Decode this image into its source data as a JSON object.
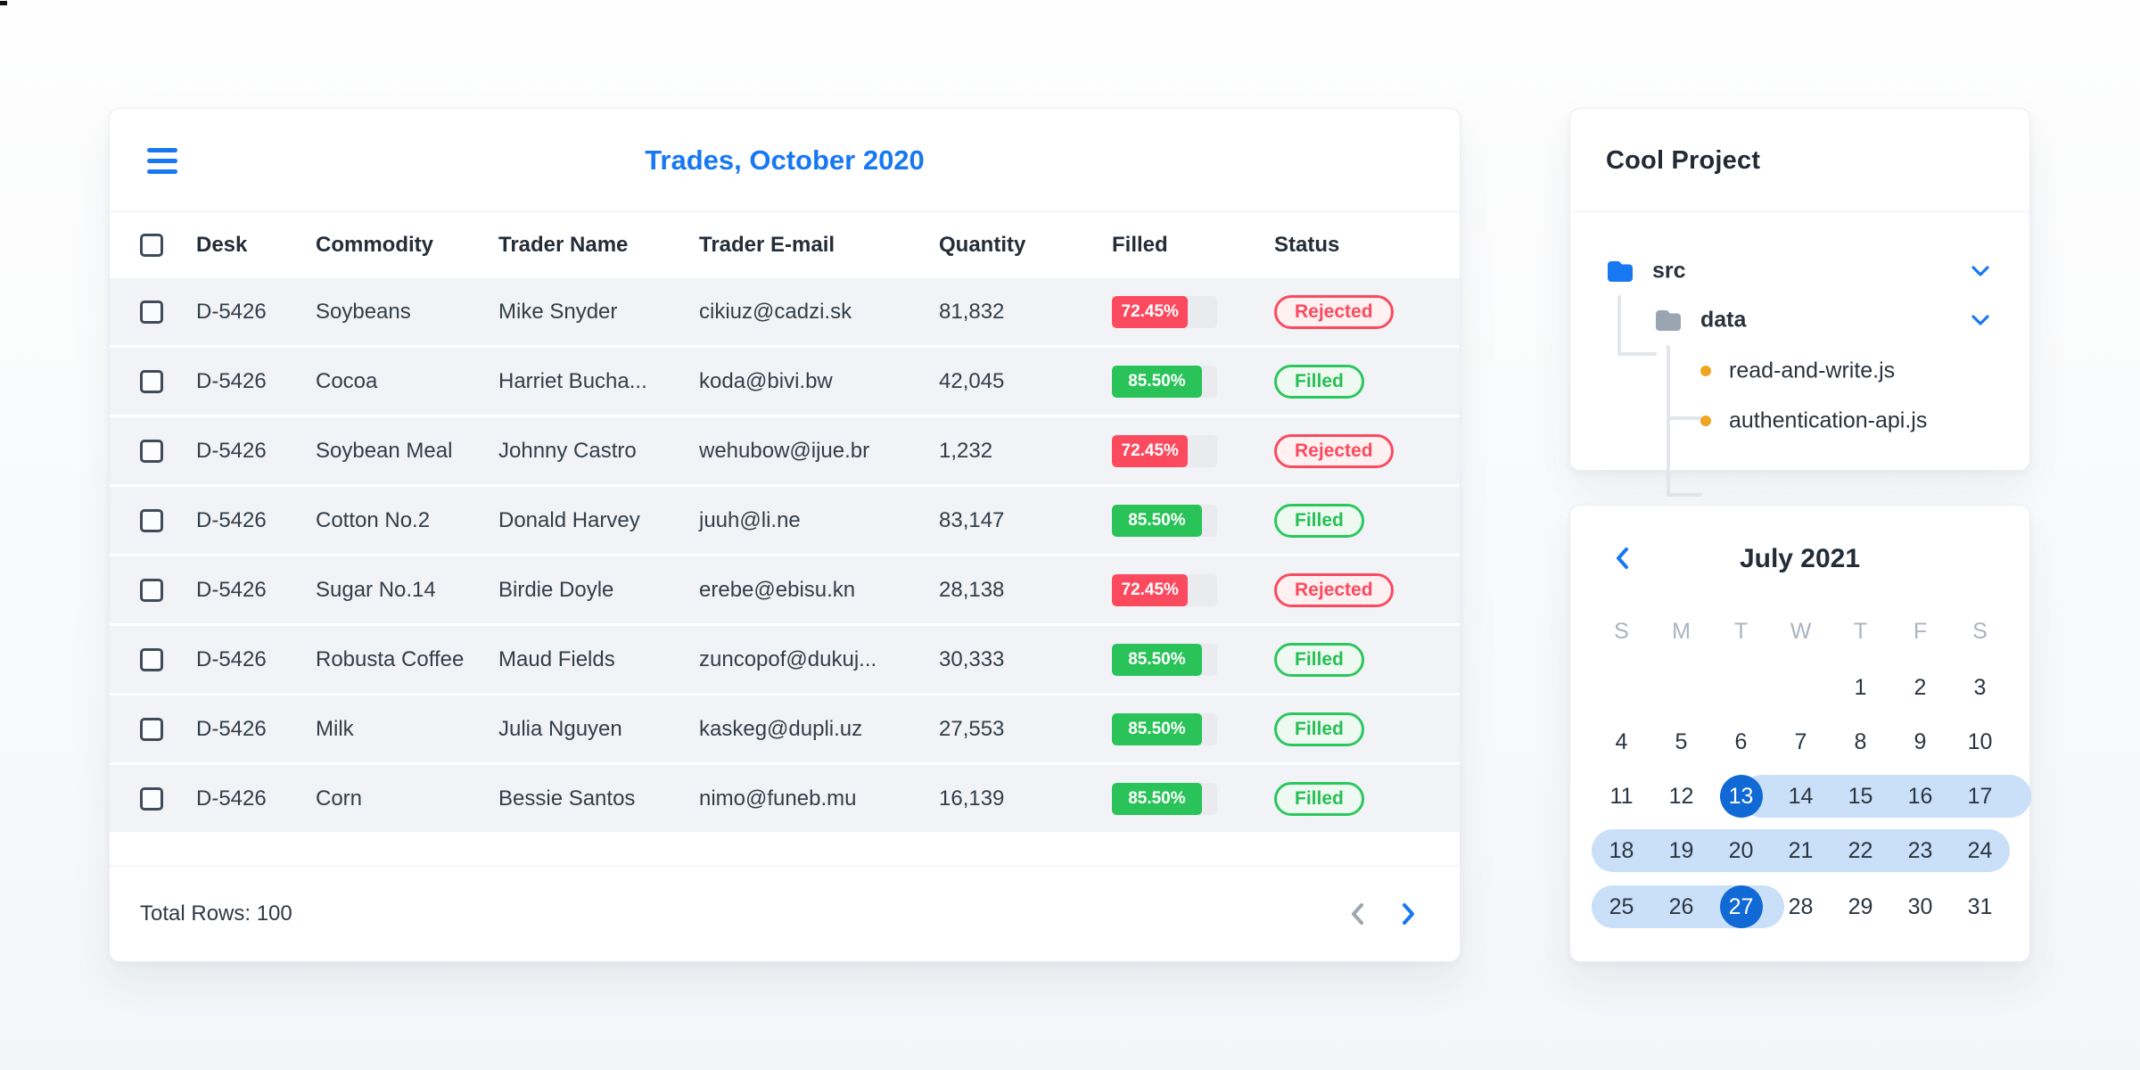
{
  "colors": {
    "accent_blue": "#1778f2",
    "selected_date_blue": "#1169d6",
    "range_light_blue": "#c9e0f8",
    "status_red": "#fb4a5e",
    "status_green": "#29c359",
    "row_bg": "#f1f3f6"
  },
  "trades_card": {
    "menu_icon": "hamburger-icon",
    "title": "Trades, October 2020",
    "columns": {
      "desk": "Desk",
      "commodity": "Commodity",
      "trader": "Trader Name",
      "email": "Trader E-mail",
      "quantity": "Quantity",
      "filled": "Filled",
      "status": "Status"
    },
    "rows": [
      {
        "desk": "D-5426",
        "commodity": "Soybeans",
        "trader": "Mike Snyder",
        "email": "cikiuz@cadzi.sk",
        "quantity": "81,832",
        "filled_label": "72.45%",
        "filled_pct": 72.45,
        "status": "Rejected"
      },
      {
        "desk": "D-5426",
        "commodity": "Cocoa",
        "trader": "Harriet Bucha...",
        "email": "koda@bivi.bw",
        "quantity": "42,045",
        "filled_label": "85.50%",
        "filled_pct": 85.5,
        "status": "Filled"
      },
      {
        "desk": "D-5426",
        "commodity": "Soybean Meal",
        "trader": "Johnny Castro",
        "email": "wehubow@ijue.br",
        "quantity": "1,232",
        "filled_label": "72.45%",
        "filled_pct": 72.45,
        "status": "Rejected"
      },
      {
        "desk": "D-5426",
        "commodity": "Cotton No.2",
        "trader": "Donald Harvey",
        "email": "juuh@li.ne",
        "quantity": "83,147",
        "filled_label": "85.50%",
        "filled_pct": 85.5,
        "status": "Filled"
      },
      {
        "desk": "D-5426",
        "commodity": "Sugar No.14",
        "trader": "Birdie Doyle",
        "email": "erebe@ebisu.kn",
        "quantity": "28,138",
        "filled_label": "72.45%",
        "filled_pct": 72.45,
        "status": "Rejected"
      },
      {
        "desk": "D-5426",
        "commodity": "Robusta Coffee",
        "trader": "Maud Fields",
        "email": "zuncopof@dukuj...",
        "quantity": "30,333",
        "filled_label": "85.50%",
        "filled_pct": 85.5,
        "status": "Filled"
      },
      {
        "desk": "D-5426",
        "commodity": "Milk",
        "trader": "Julia Nguyen",
        "email": "kaskeg@dupli.uz",
        "quantity": "27,553",
        "filled_label": "85.50%",
        "filled_pct": 85.5,
        "status": "Filled"
      },
      {
        "desk": "D-5426",
        "commodity": "Corn",
        "trader": "Bessie Santos",
        "email": "nimo@funeb.mu",
        "quantity": "16,139",
        "filled_label": "85.50%",
        "filled_pct": 85.5,
        "status": "Filled"
      }
    ],
    "footer": {
      "total_label": "Total Rows: 100",
      "prev_icon": "chevron-left-icon",
      "next_icon": "chevron-right-icon"
    }
  },
  "project_card": {
    "title": "Cool Project",
    "tree": [
      {
        "label": "src",
        "type": "folder",
        "icon": "folder-icon-blue",
        "expand_icon": "chevron-down-icon"
      },
      {
        "label": "data",
        "type": "folder",
        "icon": "folder-icon-gray",
        "expand_icon": "chevron-down-icon"
      },
      {
        "label": "read-and-write.js",
        "type": "file",
        "icon": "file-dot-icon"
      },
      {
        "label": "authentication-api.js",
        "type": "file",
        "icon": "file-dot-icon"
      }
    ]
  },
  "calendar_card": {
    "prev_icon": "chevron-left-icon",
    "title": "July 2021",
    "day_headers": [
      "S",
      "M",
      "T",
      "W",
      "T",
      "F",
      "S"
    ],
    "weeks": [
      [
        "",
        "",
        "",
        "",
        "1",
        "2",
        "3"
      ],
      [
        "4",
        "5",
        "6",
        "7",
        "8",
        "9",
        "10"
      ],
      [
        "11",
        "12",
        "13",
        "14",
        "15",
        "16",
        "17"
      ],
      [
        "18",
        "19",
        "20",
        "21",
        "22",
        "23",
        "24"
      ],
      [
        "25",
        "26",
        "27",
        "28",
        "29",
        "30",
        "31"
      ]
    ],
    "selected_range": {
      "start": "13",
      "end": "27"
    }
  }
}
